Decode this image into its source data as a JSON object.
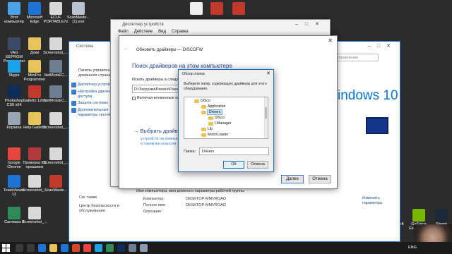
{
  "desktop_icons": [
    {
      "id": "this-pc",
      "label": "Этот\nкомпьютер",
      "color": "#4aa3e8"
    },
    {
      "id": "edge",
      "label": "Microsoft\nEdge",
      "color": "#1e74d4"
    },
    {
      "id": "ecuf",
      "label": "ECUF\nPORTABLE7z",
      "color": "#d9d9d9"
    },
    {
      "id": "scanmaster",
      "label": "ScanMaste...\n(1).exe",
      "color": "#b9c3cf"
    },
    {
      "id": "vag-eeprom",
      "label": "VAG EEPROM\nProgrammer",
      "color": "#3c4a66"
    },
    {
      "id": "docs",
      "label": "Доки",
      "color": "#e8c25a"
    },
    {
      "id": "screenshot1",
      "label": "Screenshot_...",
      "color": "#d9d9d9"
    },
    {
      "id": "skype",
      "label": "Skype",
      "color": "#1ea1e6"
    },
    {
      "id": "minipro",
      "label": "MiniPro\nProgrammer",
      "color": "#e8c25a"
    },
    {
      "id": "nefmoto1",
      "label": "NefMotoEC...",
      "color": "#6c7f92"
    },
    {
      "id": "photoshop",
      "label": "Photoshop\nCS6 x64",
      "color": "#0e2e5a"
    },
    {
      "id": "galletto",
      "label": "Galletto 1261",
      "color": "#c0392b"
    },
    {
      "id": "nefmoto2",
      "label": "NefMotoEC...",
      "color": "#6c7f92"
    },
    {
      "id": "recycle",
      "label": "Корзина",
      "color": "#9aa7b3"
    },
    {
      "id": "help-galletto",
      "label": "Help Galletto",
      "color": "#e8c25a"
    },
    {
      "id": "screenshot2",
      "label": "Screenshot_...",
      "color": "#d9d9d9"
    },
    {
      "id": "chrome",
      "label": "Google\nChrome",
      "color": "#e8453c"
    },
    {
      "id": "check-kc",
      "label": "Проверка КС\nпрошивок",
      "color": "#b33a3a"
    },
    {
      "id": "screenshot3",
      "label": "Screenshot_...",
      "color": "#d9d9d9"
    },
    {
      "id": "teamviewer",
      "label": "TeamViewer\n13",
      "color": "#1e74d4"
    },
    {
      "id": "screenshot4",
      "label": "Screenshot_...",
      "color": "#d9d9d9"
    },
    {
      "id": "scanmaster2",
      "label": "ScanMaste...",
      "color": "#c0392b"
    },
    {
      "id": "camtasia",
      "label": "Camtasia 9",
      "color": "#2e8b57"
    },
    {
      "id": "screenshot5",
      "label": "Screenshot_...",
      "color": "#d9d9d9"
    },
    {
      "id": "gta",
      "label": "Grand Theft\nAuto V",
      "color": "#3b3b3b"
    },
    {
      "id": "geforce",
      "label": "GeForce\nExperience",
      "color": "#76b900"
    },
    {
      "id": "steam",
      "label": "Steam",
      "color": "#1b2838"
    },
    {
      "id": "top-file",
      "label": "",
      "color": "#eeeeee"
    },
    {
      "id": "k-app1",
      "label": "",
      "color": "#c0392b"
    },
    {
      "id": "k-app2",
      "label": "",
      "color": "#c0392b"
    }
  ],
  "system_window": {
    "title": "Система",
    "search_placeholder": "Поиск в панели управления",
    "home_link": "Панель управления — домашняя страница",
    "links": [
      "Диспетчер устройств",
      "Настройка удаленного доступа",
      "Защита системы",
      "Дополнительные параметры системы"
    ],
    "see_also": "См. также",
    "security_center": "Центр безопасности и обслуживания",
    "section_title": "Имя компьютера, имя домена и параметры рабочей группы",
    "rows": [
      {
        "label": "Компьютер:",
        "value": "DESKTOP-MMVROAO"
      },
      {
        "label": "Полное имя:",
        "value": "DESKTOP-MMVROAO"
      },
      {
        "label": "Описание:",
        "value": ""
      }
    ],
    "change_params": "Изменить параметры",
    "windows_brand": "indows 10"
  },
  "device_manager": {
    "title": "Диспетчер устройств",
    "menu": [
      "Файл",
      "Действие",
      "Вид",
      "Справка"
    ]
  },
  "wizard": {
    "title": "Обновить драйверы — DISCOFW",
    "heading": "Поиск драйверов на этом компьютере",
    "search_label": "Искать драйверы в следующем",
    "path_value": "D:\\Загрузки\\Passini\\Passini\\",
    "include_subfolders": "Включая вложенные папки",
    "choose_link": "Выбрать драйвер из списка",
    "choose_sub": "устройств на компьютере",
    "choose_sub2": "и таким же классом",
    "next_label": "Далее",
    "cancel_label": "Отмена"
  },
  "browse_dialog": {
    "title": "Обзор папок",
    "instruction": "Выберите папку, содержащую драйверы для этого оборудования.",
    "tree": [
      {
        "label": "DiSco",
        "indent": 1,
        "selected": false
      },
      {
        "label": "Application",
        "indent": 2,
        "selected": false
      },
      {
        "label": "Drivers",
        "indent": 2,
        "selected": true
      },
      {
        "label": "DiSco",
        "indent": 3,
        "selected": false
      },
      {
        "label": "LManager",
        "indent": 3,
        "selected": false
      },
      {
        "label": "Lib",
        "indent": 2,
        "selected": false
      },
      {
        "label": "MotorLoader",
        "indent": 2,
        "selected": false
      }
    ],
    "folder_label": "Папка:",
    "folder_value": "Drivers",
    "ok_label": "ОК",
    "cancel_label": "Отмена"
  },
  "taskbar": {
    "lang": "ENG",
    "apps": [
      {
        "id": "search",
        "color": "#3a3a3a"
      },
      {
        "id": "task-view",
        "color": "#3a3a3a"
      },
      {
        "id": "edge",
        "color": "#1e74d4"
      },
      {
        "id": "explorer",
        "color": "#e8c25a"
      },
      {
        "id": "store",
        "color": "#1e74d4"
      },
      {
        "id": "office",
        "color": "#d24726"
      },
      {
        "id": "chrome",
        "color": "#e8453c"
      },
      {
        "id": "skype",
        "color": "#1ea1e6"
      },
      {
        "id": "camtasia",
        "color": "#2e8b57"
      },
      {
        "id": "photoshop",
        "color": "#0e2e5a"
      },
      {
        "id": "settings",
        "color": "#6c7f92"
      },
      {
        "id": "devmgr",
        "color": "#8a9bb0"
      }
    ]
  }
}
